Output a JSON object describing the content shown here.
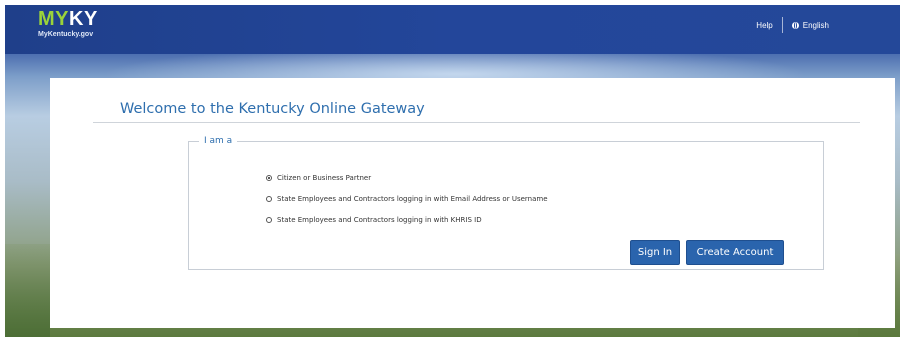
{
  "header": {
    "logo_my": "MY",
    "logo_ky": "KY",
    "logo_sub": "MyKentucky.gov",
    "help_label": "Help",
    "language_label": "English"
  },
  "page": {
    "title": "Welcome to the Kentucky Online Gateway"
  },
  "form": {
    "legend": "I am a",
    "options": [
      {
        "label": "Citizen or Business Partner",
        "selected": true
      },
      {
        "label": "State Employees and Contractors logging in with Email Address or Username",
        "selected": false
      },
      {
        "label": "State Employees and Contractors logging in with KHRIS ID",
        "selected": false
      }
    ],
    "sign_in_label": "Sign In",
    "create_account_label": "Create Account"
  },
  "colors": {
    "header_blue": "#23469a",
    "logo_green": "#9bd33a",
    "title_blue": "#2f6fae",
    "button_blue": "#2a64ad"
  }
}
